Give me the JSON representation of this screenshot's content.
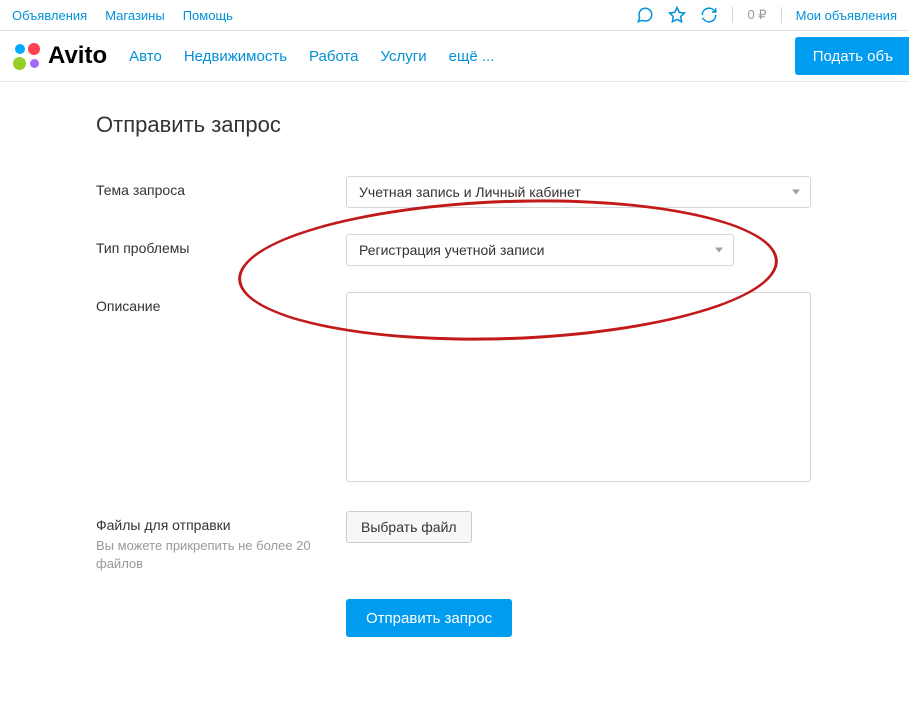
{
  "topbar": {
    "links": [
      "Объявления",
      "Магазины",
      "Помощь"
    ],
    "balance": "0 ₽",
    "myads": "Мои объявления"
  },
  "nav": {
    "logo": "Avito",
    "items": [
      "Авто",
      "Недвижимость",
      "Работа",
      "Услуги",
      "ещё ..."
    ],
    "post_button": "Подать объ"
  },
  "page": {
    "title": "Отправить запрос"
  },
  "form": {
    "topic_label": "Тема запроса",
    "topic_value": "Учетная запись и Личный кабинет",
    "type_label": "Тип проблемы",
    "type_value": "Регистрация учетной записи",
    "description_label": "Описание",
    "files_label": "Файлы для отправки",
    "files_hint": "Вы можете прикрепить не более 20 файлов",
    "file_button": "Выбрать файл",
    "submit_button": "Отправить запрос"
  }
}
